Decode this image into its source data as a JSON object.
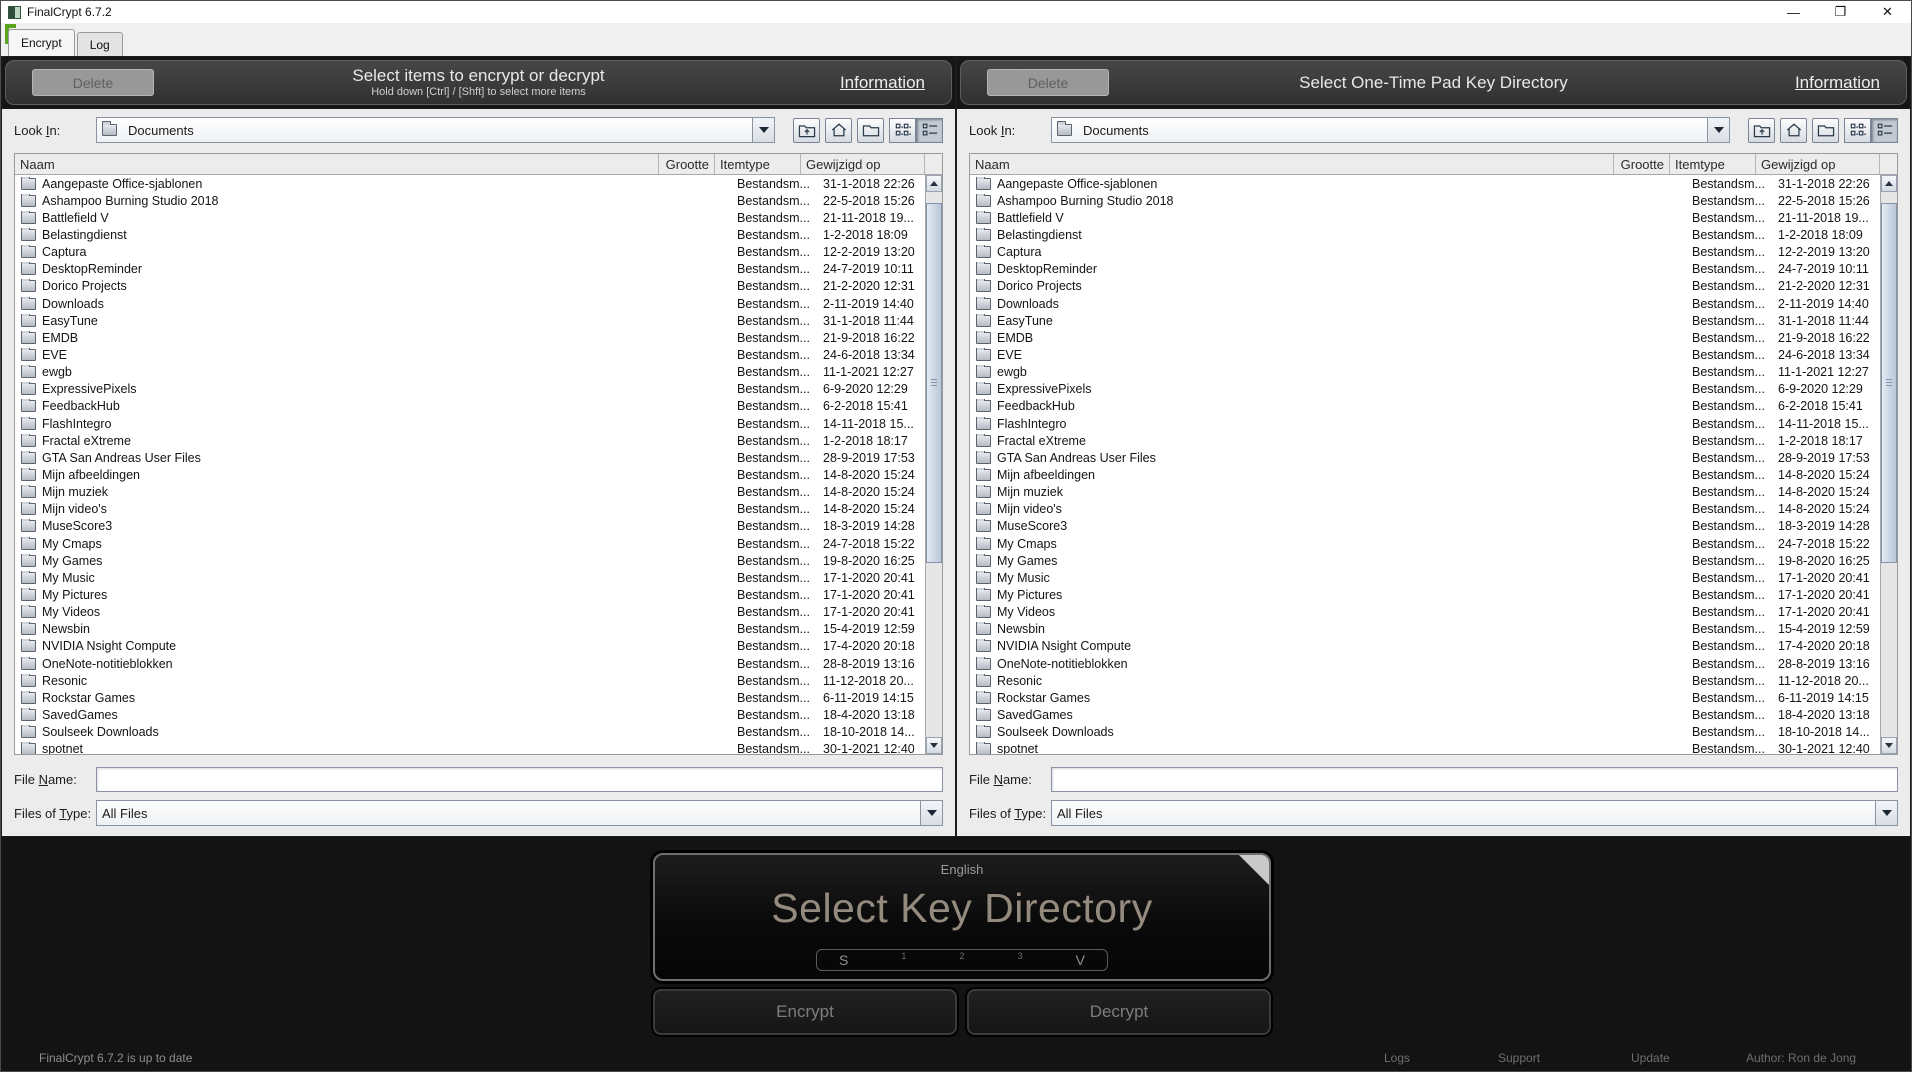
{
  "window": {
    "title": "FinalCrypt 6.7.2",
    "controls": {
      "minimize": "—",
      "restore": "❐",
      "close": "✕"
    }
  },
  "tabs": [
    {
      "label": "Encrypt",
      "active": true
    },
    {
      "label": "Log",
      "active": false
    }
  ],
  "left_panel": {
    "delete_label": "Delete",
    "title": "Select items to encrypt or decrypt",
    "subtitle": "Hold down [Ctrl] / [Shft] to select more items",
    "information_label": "Information"
  },
  "right_panel": {
    "delete_label": "Delete",
    "title": "Select One-Time Pad Key Directory",
    "information_label": "Information"
  },
  "filechooser": {
    "look_in_label": "Look In:",
    "look_in_value": "Documents",
    "toolbar_icons": [
      "up-folder",
      "home",
      "new-folder",
      "icons-view",
      "list-view"
    ],
    "columns": [
      "Naam",
      "Grootte",
      "Itemtype",
      "Gewijzigd op"
    ],
    "file_name_label": "File Name:",
    "file_name_value": "",
    "files_of_type_label": "Files of Type:",
    "files_of_type_value": "All Files",
    "rows": [
      {
        "name": "Aangepaste Office-sjablonen",
        "size": "",
        "type": "Bestandsm...",
        "modified": "31-1-2018 22:26"
      },
      {
        "name": "Ashampoo Burning Studio 2018",
        "size": "",
        "type": "Bestandsm...",
        "modified": "22-5-2018 15:26"
      },
      {
        "name": "Battlefield V",
        "size": "",
        "type": "Bestandsm...",
        "modified": "21-11-2018 19..."
      },
      {
        "name": "Belastingdienst",
        "size": "",
        "type": "Bestandsm...",
        "modified": "1-2-2018 18:09"
      },
      {
        "name": "Captura",
        "size": "",
        "type": "Bestandsm...",
        "modified": "12-2-2019 13:20"
      },
      {
        "name": "DesktopReminder",
        "size": "",
        "type": "Bestandsm...",
        "modified": "24-7-2019 10:11"
      },
      {
        "name": "Dorico Projects",
        "size": "",
        "type": "Bestandsm...",
        "modified": "21-2-2020 12:31"
      },
      {
        "name": "Downloads",
        "size": "",
        "type": "Bestandsm...",
        "modified": "2-11-2019 14:40"
      },
      {
        "name": "EasyTune",
        "size": "",
        "type": "Bestandsm...",
        "modified": "31-1-2018 11:44"
      },
      {
        "name": "EMDB",
        "size": "",
        "type": "Bestandsm...",
        "modified": "21-9-2018 16:22"
      },
      {
        "name": "EVE",
        "size": "",
        "type": "Bestandsm...",
        "modified": "24-6-2018 13:34"
      },
      {
        "name": "ewgb",
        "size": "",
        "type": "Bestandsm...",
        "modified": "11-1-2021 12:27"
      },
      {
        "name": "ExpressivePixels",
        "size": "",
        "type": "Bestandsm...",
        "modified": "6-9-2020 12:29"
      },
      {
        "name": "FeedbackHub",
        "size": "",
        "type": "Bestandsm...",
        "modified": "6-2-2018 15:41"
      },
      {
        "name": "FlashIntegro",
        "size": "",
        "type": "Bestandsm...",
        "modified": "14-11-2018 15..."
      },
      {
        "name": "Fractal eXtreme",
        "size": "",
        "type": "Bestandsm...",
        "modified": "1-2-2018 18:17"
      },
      {
        "name": "GTA San Andreas User Files",
        "size": "",
        "type": "Bestandsm...",
        "modified": "28-9-2019 17:53"
      },
      {
        "name": "Mijn afbeeldingen",
        "size": "",
        "type": "Bestandsm...",
        "modified": "14-8-2020 15:24"
      },
      {
        "name": "Mijn muziek",
        "size": "",
        "type": "Bestandsm...",
        "modified": "14-8-2020 15:24"
      },
      {
        "name": "Mijn video's",
        "size": "",
        "type": "Bestandsm...",
        "modified": "14-8-2020 15:24"
      },
      {
        "name": "MuseScore3",
        "size": "",
        "type": "Bestandsm...",
        "modified": "18-3-2019 14:28"
      },
      {
        "name": "My Cmaps",
        "size": "",
        "type": "Bestandsm...",
        "modified": "24-7-2018 15:22"
      },
      {
        "name": "My Games",
        "size": "",
        "type": "Bestandsm...",
        "modified": "19-8-2020 16:25"
      },
      {
        "name": "My Music",
        "size": "",
        "type": "Bestandsm...",
        "modified": "17-1-2020 20:41"
      },
      {
        "name": "My Pictures",
        "size": "",
        "type": "Bestandsm...",
        "modified": "17-1-2020 20:41"
      },
      {
        "name": "My Videos",
        "size": "",
        "type": "Bestandsm...",
        "modified": "17-1-2020 20:41"
      },
      {
        "name": "Newsbin",
        "size": "",
        "type": "Bestandsm...",
        "modified": "15-4-2019 12:59"
      },
      {
        "name": "NVIDIA Nsight Compute",
        "size": "",
        "type": "Bestandsm...",
        "modified": "17-4-2020 20:18"
      },
      {
        "name": "OneNote-notitieblokken",
        "size": "",
        "type": "Bestandsm...",
        "modified": "28-8-2019 13:16"
      },
      {
        "name": "Resonic",
        "size": "",
        "type": "Bestandsm...",
        "modified": "11-12-2018 20..."
      },
      {
        "name": "Rockstar Games",
        "size": "",
        "type": "Bestandsm...",
        "modified": "6-11-2019 14:15"
      },
      {
        "name": "SavedGames",
        "size": "",
        "type": "Bestandsm...",
        "modified": "18-4-2020 13:18"
      },
      {
        "name": "Soulseek Downloads",
        "size": "",
        "type": "Bestandsm...",
        "modified": "18-10-2018 14..."
      },
      {
        "name": "spotnet",
        "size": "",
        "type": "Bestandsm...",
        "modified": "30-1-2021 12:40"
      }
    ]
  },
  "footer": {
    "language": "English",
    "main_action": "Select Key Directory",
    "indicator": {
      "s": "S",
      "d1": "1",
      "d2": "2",
      "d3": "3",
      "v": "V"
    },
    "encrypt_label": "Encrypt",
    "decrypt_label": "Decrypt",
    "status": "FinalCrypt 6.7.2 is up to date",
    "links": [
      "Logs",
      "Support",
      "Update"
    ],
    "author": "Author: Ron de Jong"
  }
}
